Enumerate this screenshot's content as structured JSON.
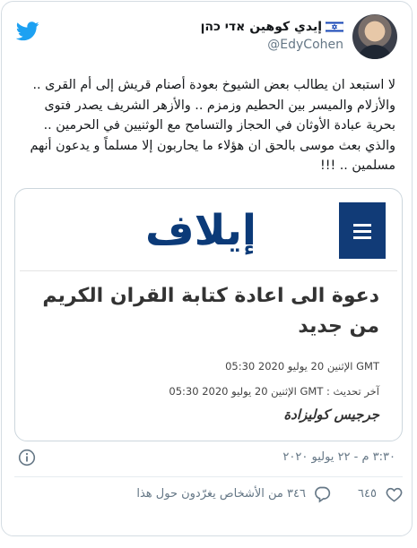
{
  "author": {
    "display_name": "إيدي كوهين אדי כהן",
    "handle": "@EdyCohen",
    "flag_icon": "israel-flag-icon"
  },
  "tweet": {
    "text": "لا استبعد ان يطالب بعض الشيوخ بعودة أصنام قريش إلى أم القرى .. والأزلام والميسر بين الحطيم وزمزم .. والأزهر الشريف يصدر فتوى بحرية عبادة الأوثان في الحجاز والتسامح مع الوثنيين في الحرمين .. والذي بعث موسى بالحق ان هؤلاء ما يحاربون إلا مسلماً و يدعون أنهم مسلمين .. !!!",
    "timestamp": "٣:٣٠ م - ٢٢ يوليو ٢٠٢٠"
  },
  "media": {
    "site_logo": "إيلاف",
    "headline": "دعوة الى اعادة كتابة القران الكريم من جديد",
    "published": "GMT الإثنين 20 يوليو 2020 05:30",
    "updated": "آخر تحديث : GMT الإثنين 20 يوليو 2020 05:30",
    "byline": "جرجيس كوليزادة"
  },
  "actions": {
    "likes": "٦٤٥",
    "replies_text": "٣٤٦ من الأشخاص يغرّدون حول هذا"
  },
  "colors": {
    "twitter_blue": "#1da1f2",
    "elaph_navy": "#0b3a78",
    "muted": "#657786"
  }
}
